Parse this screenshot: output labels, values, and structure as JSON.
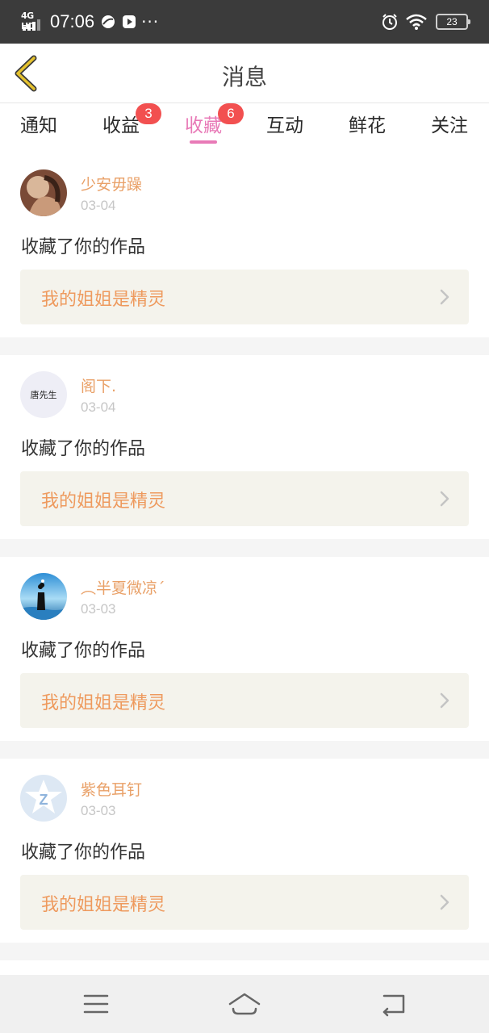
{
  "status_bar": {
    "network": "4G HD",
    "time": "07:06",
    "more": "···",
    "battery": "23"
  },
  "header": {
    "title": "消息",
    "back_icon": "chevron-left-icon",
    "accent_color": "#e5c22e"
  },
  "tabs": [
    {
      "label": "通知",
      "badge": ""
    },
    {
      "label": "收益",
      "badge": "3"
    },
    {
      "label": "收藏",
      "badge": "6",
      "active": true
    },
    {
      "label": "互动",
      "badge": ""
    },
    {
      "label": "鲜花",
      "badge": ""
    },
    {
      "label": "关注",
      "badge": ""
    }
  ],
  "colors": {
    "tab_active": "#e87ab7",
    "badge": "#f25050",
    "username": "#e9a067",
    "work_title": "#ee9a5e",
    "work_bg": "#f4f3ec"
  },
  "notifications": [
    {
      "username": "少安毋躁",
      "date": "03-04",
      "action": "收藏了你的作品",
      "work_title": "我的姐姐是精灵"
    },
    {
      "username": "阁下.",
      "date": "03-04",
      "action": "收藏了你的作品",
      "work_title": "我的姐姐是精灵",
      "avatar_text": "唐先生"
    },
    {
      "username": "︵半夏微凉´",
      "date": "03-03",
      "action": "收藏了你的作品",
      "work_title": "我的姐姐是精灵"
    },
    {
      "username": "紫色耳钉",
      "date": "03-03",
      "action": "收藏了你的作品",
      "work_title": "我的姐姐是精灵"
    }
  ],
  "nav": {
    "menu_icon": "menu-icon",
    "home_icon": "home-icon",
    "back_icon": "back-icon"
  }
}
